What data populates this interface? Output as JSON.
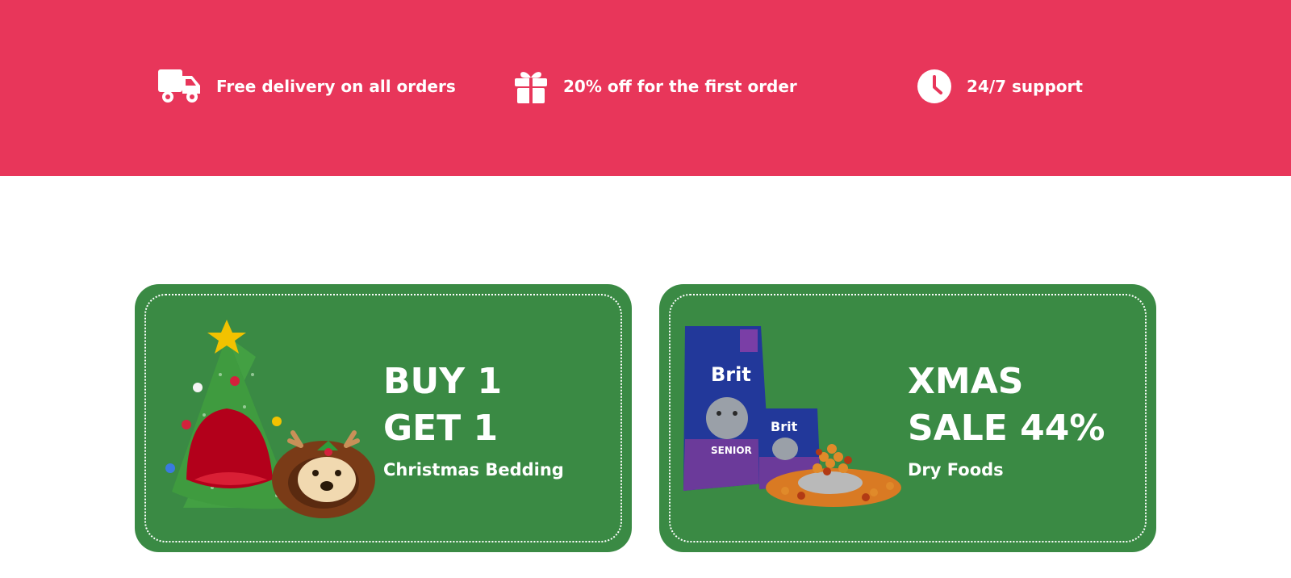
{
  "features": [
    {
      "icon": "truck-icon",
      "label": "Free delivery on all orders"
    },
    {
      "icon": "gift-icon",
      "label": "20% off for the first order"
    },
    {
      "icon": "clock-icon",
      "label": "24/7 support"
    }
  ],
  "promos": [
    {
      "line1": "BUY 1",
      "line2": "GET 1",
      "subtitle": "Christmas Bedding"
    },
    {
      "line1": "XMAS",
      "line2": "SALE 44%",
      "subtitle": "Dry Foods",
      "pack_brand": "Brit",
      "pack_label": "SENIOR"
    }
  ],
  "colors": {
    "banner": "#e8365a",
    "promo_bg": "#3a8a44",
    "text": "#ffffff"
  }
}
